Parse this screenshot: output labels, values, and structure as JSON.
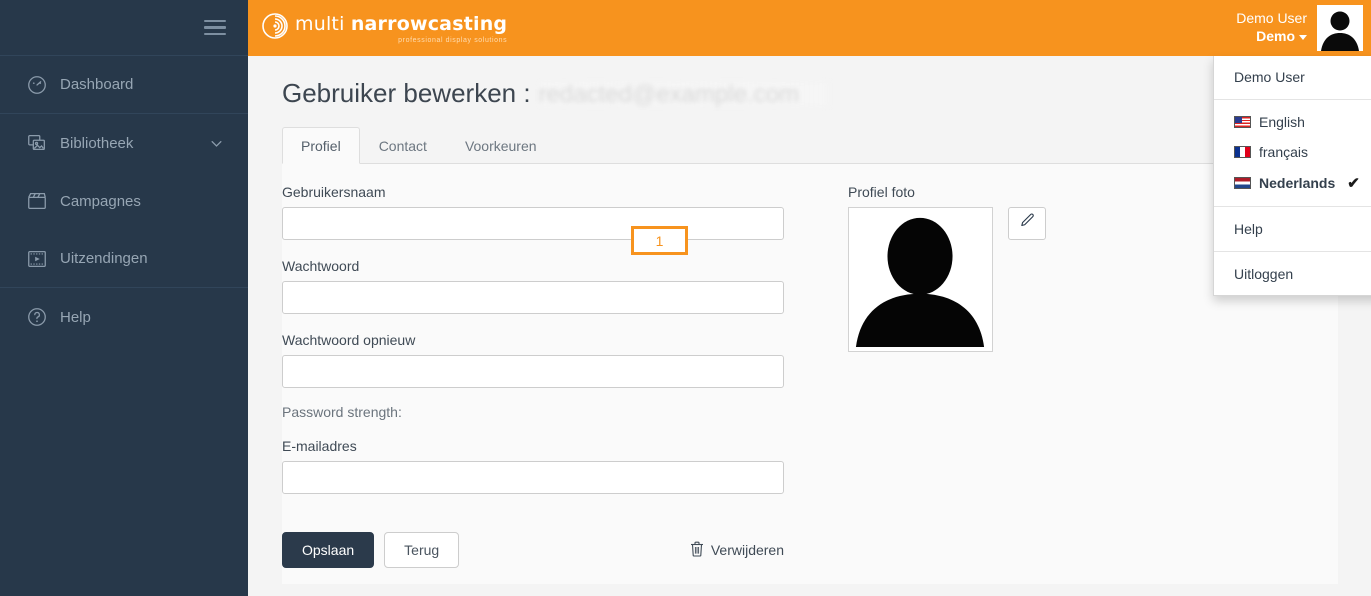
{
  "sidebar": {
    "hamburger_label": "menu-toggle",
    "items": [
      {
        "label": "Dashboard",
        "icon": "gauge-icon",
        "expandable": false
      },
      {
        "label": "Bibliotheek",
        "icon": "images-icon",
        "expandable": true
      },
      {
        "label": "Campagnes",
        "icon": "clapperboard-icon",
        "expandable": false
      },
      {
        "label": "Uitzendingen",
        "icon": "film-play-icon",
        "expandable": false
      },
      {
        "label": "Help",
        "icon": "question-circle-icon",
        "expandable": false
      }
    ]
  },
  "header": {
    "logo_main_light": "multi ",
    "logo_main_bold": "narrowcasting",
    "logo_sub": "professional display solutions",
    "user_line1": "Demo User",
    "user_line2": "Demo",
    "accent_color": "#f7931e",
    "sidebar_color": "#27384a"
  },
  "dropdown": {
    "visible": true,
    "header_item": "Demo User",
    "languages": [
      {
        "label": "English",
        "flag": "us",
        "selected": false
      },
      {
        "label": "français",
        "flag": "fr",
        "selected": false
      },
      {
        "label": "Nederlands",
        "flag": "nl",
        "selected": true
      }
    ],
    "check_glyph": "✔",
    "help_label": "Help",
    "logout_label": "Uitloggen"
  },
  "page": {
    "title_prefix": "Gebruiker bewerken :",
    "title_redacted": "redacted@example.com",
    "tabs": [
      {
        "label": "Profiel",
        "active": true
      },
      {
        "label": "Contact",
        "active": false
      },
      {
        "label": "Voorkeuren",
        "active": false
      }
    ]
  },
  "form": {
    "username_label": "Gebruikersnaam",
    "username_value": "",
    "password_label": "Wachtwoord",
    "password_value": "",
    "password_repeat_label": "Wachtwoord opnieuw",
    "password_repeat_value": "",
    "password_strength_label": "Password strength:",
    "email_label": "E-mailadres",
    "email_value": "",
    "photo_label": "Profiel foto",
    "edit_photo_icon": "pencil-icon"
  },
  "buttons": {
    "save": "Opslaan",
    "back": "Terug",
    "delete": "Verwijderen",
    "delete_icon": "trash-icon"
  },
  "annotation": {
    "marker_number": "1",
    "color": "#f7931e"
  }
}
